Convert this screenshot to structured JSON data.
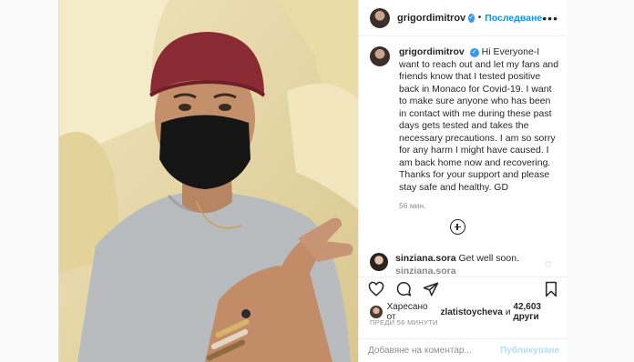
{
  "post": {
    "username": "grigordimitrov",
    "follow_label": "Последване",
    "verified_mark": "✓",
    "more_glyph": "•••",
    "caption": {
      "username": "grigordimitrov",
      "text": "Hi Everyone-I want to reach out and let my fans and friends know that I tested positive back in Monaco for Covid-19. I want to make sure anyone who has been in contact with me during these past days gets tested and takes the necessary precautions. I am so sorry for any harm I might have caused. I am back home now and recovering. Thanks for your support and please stay safe and healthy. GD",
      "time": "56 мин."
    },
    "comments": [
      {
        "username": "sinziana.sora",
        "text": "Get well soon."
      },
      {
        "username": "sinziana.sora"
      }
    ],
    "likes": {
      "prefix": "Харесано от",
      "user": "zlatistoycheva",
      "conj": "и",
      "count": "42,603 други"
    },
    "posted_ago": "ПРЕДИ 56 МИНУТИ",
    "add_comment_placeholder": "Добавяне на коментар...",
    "publish_label": "Публикуване"
  },
  "icons": [
    "heart-icon",
    "comment-icon",
    "share-icon",
    "bookmark-icon",
    "more-icon",
    "load-more-icon",
    "verified-icon"
  ],
  "colors": {
    "accent": "#0095f6",
    "publish_disabled": "#b2dffc",
    "muted": "#8e8e8e",
    "text": "#262626"
  }
}
